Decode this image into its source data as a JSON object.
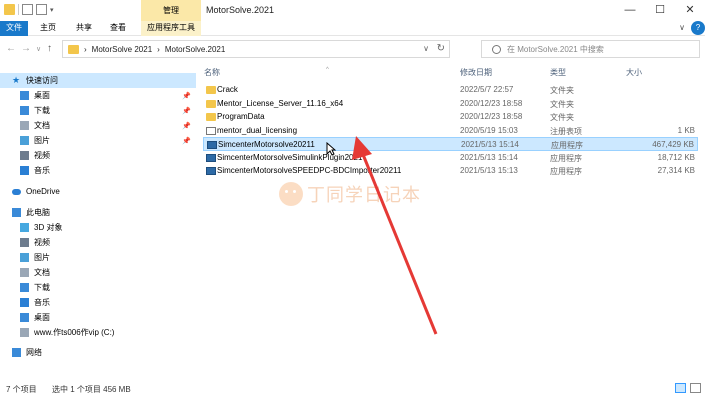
{
  "window": {
    "title": "MotorSolve.2021",
    "manage_label": "管理",
    "minimize": "—",
    "maximize": "☐",
    "close": "✕"
  },
  "ribbon": {
    "file": "文件",
    "home": "主页",
    "share": "共享",
    "view": "查看",
    "app_tools": "应用程序工具",
    "expand": "∨",
    "help": "?"
  },
  "address": {
    "back": "←",
    "forward": "→",
    "recent": "∨",
    "up": "↑",
    "crumbs": [
      "MotorSolve 2021",
      "MotorSolve.2021"
    ],
    "sep": "›",
    "dropdown": "∨",
    "refresh": "↻"
  },
  "search": {
    "placeholder": "在 MotorSolve.2021 中搜索"
  },
  "sidebar": {
    "quick_access": "快速访问",
    "quick_items": [
      {
        "label": "桌面",
        "icon": "desktop-icon"
      },
      {
        "label": "下载",
        "icon": "download-icon"
      },
      {
        "label": "文档",
        "icon": "document-icon"
      },
      {
        "label": "图片",
        "icon": "picture-icon"
      },
      {
        "label": "视频",
        "icon": "video-icon"
      },
      {
        "label": "音乐",
        "icon": "music-icon"
      }
    ],
    "onedrive": "OneDrive",
    "this_pc": "此电脑",
    "pc_items": [
      {
        "label": "3D 对象",
        "icon": "3d-objects-icon"
      },
      {
        "label": "视频",
        "icon": "video-icon"
      },
      {
        "label": "图片",
        "icon": "picture-icon"
      },
      {
        "label": "文档",
        "icon": "document-icon"
      },
      {
        "label": "下载",
        "icon": "download-icon"
      },
      {
        "label": "音乐",
        "icon": "music-icon"
      },
      {
        "label": "桌面",
        "icon": "desktop-icon"
      },
      {
        "label": "www.作ts006作vip (C:)",
        "icon": "drive-icon"
      }
    ],
    "network": "网络"
  },
  "columns": {
    "name": "名称",
    "modified": "修改日期",
    "type": "类型",
    "size": "大小",
    "sort_arrow": "^"
  },
  "files": [
    {
      "name": "Crack",
      "date": "2022/5/7 22:57",
      "type": "文件夹",
      "size": "",
      "icon": "folder-icon"
    },
    {
      "name": "Mentor_License_Server_11.16_x64",
      "date": "2020/12/23 18:58",
      "type": "文件夹",
      "size": "",
      "icon": "folder-icon"
    },
    {
      "name": "ProgramData",
      "date": "2020/12/23 18:58",
      "type": "文件夹",
      "size": "",
      "icon": "folder-icon"
    },
    {
      "name": "mentor_dual_licensing",
      "date": "2020/5/19 15:03",
      "type": "注册表项",
      "size": "1 KB",
      "icon": "registry-file-icon"
    },
    {
      "name": "SimcenterMotorsolve20211",
      "date": "2021/5/13 15:14",
      "type": "应用程序",
      "size": "467,429 KB",
      "icon": "app-icon"
    },
    {
      "name": "SimcenterMotorsolveSimulinkPlugin2021",
      "date": "2021/5/13 15:14",
      "type": "应用程序",
      "size": "18,712 KB",
      "icon": "app-icon"
    },
    {
      "name": "SimcenterMotorsolveSPEEDPC-BDCImporter20211",
      "date": "2021/5/13 15:13",
      "type": "应用程序",
      "size": "27,314 KB",
      "icon": "app-icon"
    }
  ],
  "selected_index": 4,
  "watermark": "丁同学日记本",
  "status": {
    "count": "7 个项目",
    "selected": "选中 1 个项目  456 MB"
  },
  "colors": {
    "accent": "#1979ca",
    "selection": "#cce8ff",
    "arrow": "#e53935"
  }
}
